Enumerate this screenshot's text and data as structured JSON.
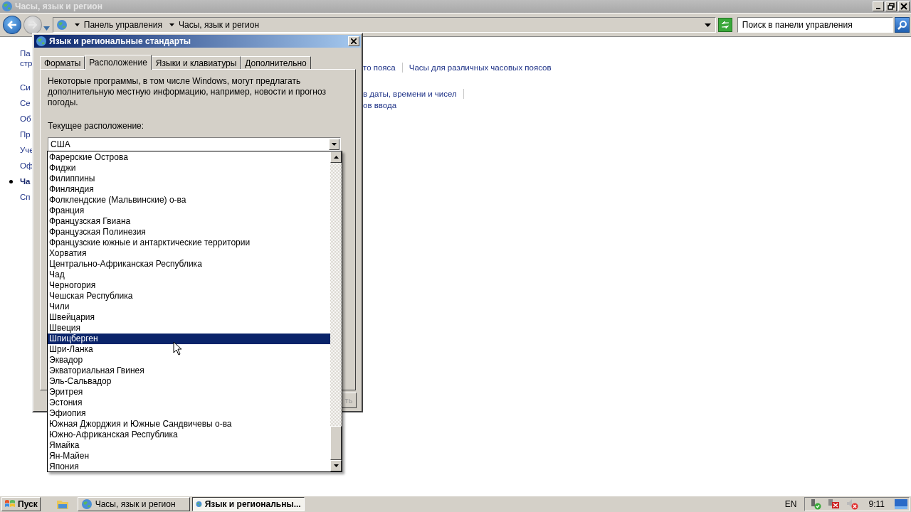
{
  "background_window": {
    "title": "Часы, язык и регион",
    "breadcrumb": [
      "Панель управления",
      "Часы, язык и регион"
    ],
    "search": {
      "placeholder": "Поиск в панели управления"
    },
    "sidebar_home": [
      "Па",
      "стр"
    ],
    "sidebar": [
      {
        "label": "Си",
        "selected": false
      },
      {
        "label": "Се",
        "selected": false
      },
      {
        "label": "Об",
        "selected": false
      },
      {
        "label": "Пр",
        "selected": false
      },
      {
        "label": "Уче",
        "selected": false
      },
      {
        "label": "Оф",
        "selected": false
      },
      {
        "label": "Ча",
        "selected": true
      },
      {
        "label": "Сп",
        "selected": false
      }
    ],
    "link_groups": [
      [
        [
          "то пояса",
          "Часы для различных часовых поясов"
        ]
      ],
      [
        [
          "в даты, времени и чисел"
        ],
        [
          "ов ввода"
        ]
      ]
    ]
  },
  "dialog": {
    "title": "Язык и региональные стандарты",
    "tabs": [
      {
        "label": "Форматы",
        "selected": false
      },
      {
        "label": "Расположение",
        "selected": true
      },
      {
        "label": "Языки и клавиатуры",
        "selected": false
      },
      {
        "label": "Дополнительно",
        "selected": false
      }
    ],
    "description": "Некоторые программы, в том числе Windows, могут предлагать дополнительную местную информацию, например, новости и прогноз погоды.",
    "location_label": "Текущее расположение:",
    "location": {
      "value": "США"
    },
    "button_fragment": "ть",
    "dropdown": [
      {
        "label": "Фарерские Острова",
        "selected": false
      },
      {
        "label": "Фиджи",
        "selected": false
      },
      {
        "label": "Филиппины",
        "selected": false
      },
      {
        "label": "Финляндия",
        "selected": false
      },
      {
        "label": "Фолклендские (Мальвинские) о-ва",
        "selected": false
      },
      {
        "label": "Франция",
        "selected": false
      },
      {
        "label": "Французская Гвиана",
        "selected": false
      },
      {
        "label": "Французская Полинезия",
        "selected": false
      },
      {
        "label": "Французские южные и антарктические территории",
        "selected": false
      },
      {
        "label": "Хорватия",
        "selected": false
      },
      {
        "label": "Центрально-Африканская Республика",
        "selected": false
      },
      {
        "label": "Чад",
        "selected": false
      },
      {
        "label": "Черногория",
        "selected": false
      },
      {
        "label": "Чешская Республика",
        "selected": false
      },
      {
        "label": "Чили",
        "selected": false
      },
      {
        "label": "Швейцария",
        "selected": false
      },
      {
        "label": "Швеция",
        "selected": false
      },
      {
        "label": "Шпицберген",
        "selected": true
      },
      {
        "label": "Шри-Ланка",
        "selected": false
      },
      {
        "label": "Эквадор",
        "selected": false
      },
      {
        "label": "Экваториальная Гвинея",
        "selected": false
      },
      {
        "label": "Эль-Сальвадор",
        "selected": false
      },
      {
        "label": "Эритрея",
        "selected": false
      },
      {
        "label": "Эстония",
        "selected": false
      },
      {
        "label": "Эфиопия",
        "selected": false
      },
      {
        "label": "Южная Джорджия и Южные Сандвичевы о-ва",
        "selected": false
      },
      {
        "label": "Южно-Африканская Республика",
        "selected": false
      },
      {
        "label": "Ямайка",
        "selected": false
      },
      {
        "label": "Ян-Майен",
        "selected": false
      },
      {
        "label": "Япония",
        "selected": false
      }
    ]
  },
  "taskbar": {
    "start": "Пуск",
    "tasks": [
      {
        "label": "Часы, язык и регион",
        "selected": false
      },
      {
        "label": "Язык и региональны...",
        "selected": true
      }
    ],
    "language": "EN",
    "clock": "9:11"
  }
}
